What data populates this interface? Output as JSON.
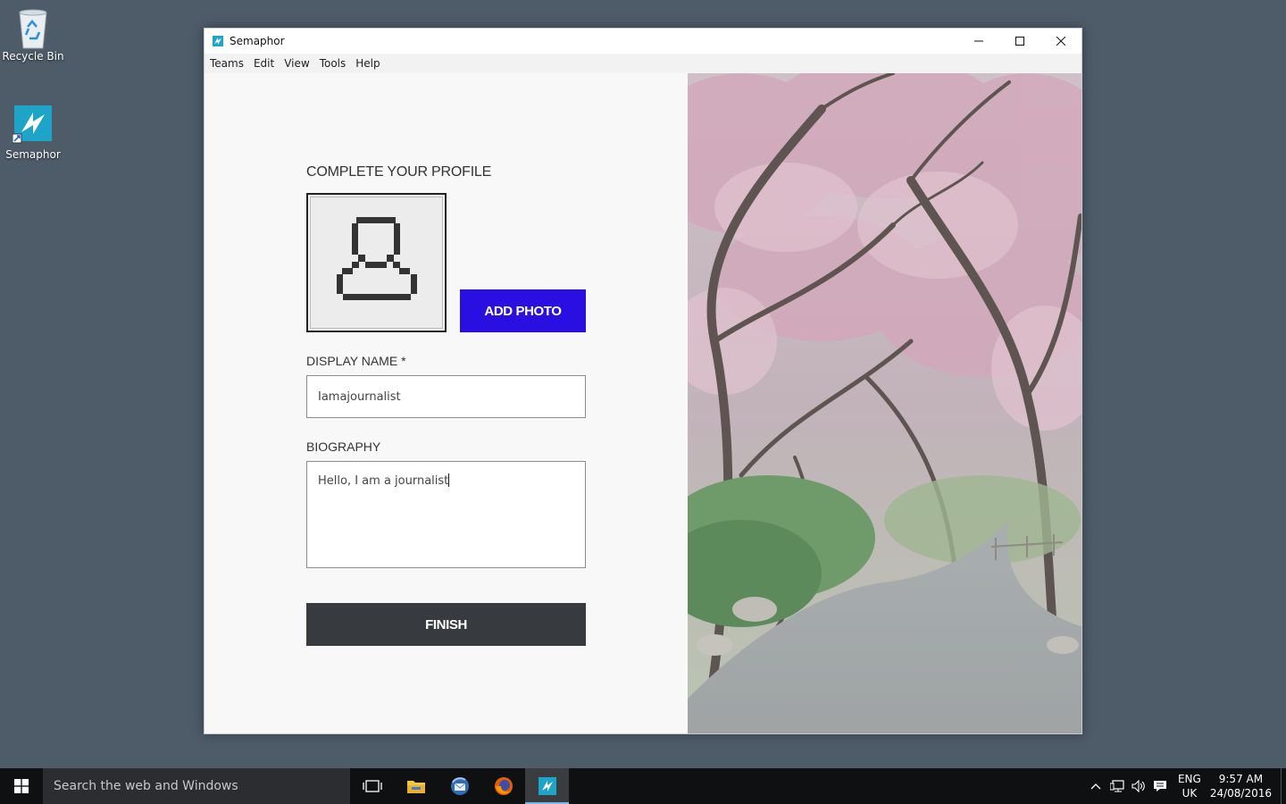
{
  "desktop": {
    "icons": [
      {
        "label": "Recycle Bin"
      },
      {
        "label": "Semaphor"
      }
    ]
  },
  "window": {
    "title": "Semaphor",
    "menu": [
      "Teams",
      "Edit",
      "View",
      "Tools",
      "Help"
    ]
  },
  "profile": {
    "heading": "COMPLETE YOUR PROFILE",
    "add_photo_label": "ADD PHOTO",
    "display_name_label": "DISPLAY NAME *",
    "display_name_value": "Iamajournalist",
    "biography_label": "BIOGRAPHY",
    "biography_value": "Hello, I am a journalist",
    "finish_label": "FINISH"
  },
  "taskbar": {
    "search_placeholder": "Search the web and Windows",
    "language": "ENG",
    "region": "UK",
    "time": "9:57 AM",
    "date": "24/08/2016"
  },
  "colors": {
    "accent": "#2a10e0",
    "finish": "#373a3e",
    "desktop": "#4e5b69"
  }
}
